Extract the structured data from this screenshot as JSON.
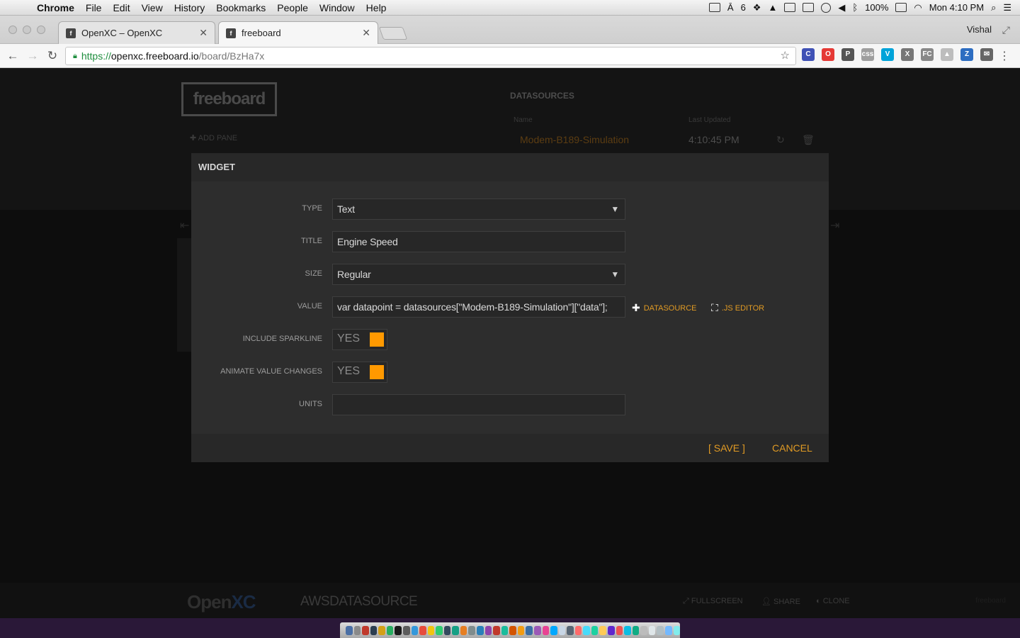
{
  "menubar": {
    "app": "Chrome",
    "items": [
      "File",
      "Edit",
      "View",
      "History",
      "Bookmarks",
      "People",
      "Window",
      "Help"
    ],
    "status": {
      "adobe_count": "6",
      "battery": "100%",
      "clock": "Mon 4:10 PM"
    }
  },
  "browser": {
    "tabs": [
      {
        "title": "OpenXC – OpenXC",
        "favicon": "f"
      },
      {
        "title": "freeboard",
        "favicon": "f"
      }
    ],
    "profile": "Vishal",
    "url": {
      "scheme": "https://",
      "host": "openxc.freeboard.io",
      "path": "/board/BzHa7x"
    },
    "extensions": [
      {
        "label": "C",
        "color": "#3f51b5"
      },
      {
        "label": "O",
        "color": "#e53935"
      },
      {
        "label": "P",
        "color": "#555555"
      },
      {
        "label": "css",
        "color": "#9e9e9e"
      },
      {
        "label": "V",
        "color": "#00a3d9"
      },
      {
        "label": "X",
        "color": "#777777"
      },
      {
        "label": "FC",
        "color": "#888888"
      },
      {
        "label": "▲",
        "color": "#bdbdbd"
      },
      {
        "label": "Z",
        "color": "#2d6dc1"
      },
      {
        "label": "✉",
        "color": "#666666"
      }
    ]
  },
  "board": {
    "logo": "freeboard",
    "add_pane": "ADD PANE",
    "datasources": {
      "title": "DATASOURCES",
      "col_name": "Name",
      "col_updated": "Last Updated",
      "rows": [
        {
          "name": "Modem-B189-Simulation",
          "updated": "4:10:45 PM"
        }
      ]
    }
  },
  "modal": {
    "title": "WIDGET",
    "type_label": "TYPE",
    "type_value": "Text",
    "title_label": "TITLE",
    "title_value": "Engine Speed",
    "size_label": "SIZE",
    "size_value": "Regular",
    "value_label": "VALUE",
    "value_value": "var datapoint = datasources[\"Modem-B189-Simulation\"][\"data\"];",
    "datasource_link": "DATASOURCE",
    "js_editor_link": ".JS EDITOR",
    "sparkline_label": "INCLUDE SPARKLINE",
    "sparkline_value": "YES",
    "animate_label": "ANIMATE VALUE CHANGES",
    "animate_value": "YES",
    "units_label": "UNITS",
    "units_value": "",
    "save": "[ SAVE ]",
    "cancel": "CANCEL",
    "accent": "#ff9900"
  },
  "footer": {
    "logo_open": "Open",
    "logo_xc": "XC",
    "board_title": "AWSDATASOURCE",
    "fullscreen": "FULLSCREEN",
    "share": "SHARE",
    "clone": "CLONE",
    "brand": "freeboard"
  },
  "dock": {
    "icon_colors": [
      "#4a6fa5",
      "#8a8a8a",
      "#c0392b",
      "#2c3e50",
      "#d4a017",
      "#27ae60",
      "#1a1a1a",
      "#5c5c5c",
      "#3498db",
      "#e74c3c",
      "#f1c40f",
      "#2ecc71",
      "#34495e",
      "#16a085",
      "#e67e22",
      "#7f8c8d",
      "#2980b9",
      "#8e44ad",
      "#c0392b",
      "#1abc9c",
      "#d35400",
      "#f39c12",
      "#3a6ea5",
      "#9b59b6",
      "#e84393",
      "#00a8ff",
      "#c8d6e5",
      "#576574",
      "#ff6b6b",
      "#48dbfb",
      "#1dd1a1",
      "#feca57",
      "#5f27cd",
      "#ee5253",
      "#0abde3",
      "#10ac84",
      "#bcbcbc",
      "#dfe6e9",
      "#b2bec3",
      "#74b9ff",
      "#81ecec"
    ]
  }
}
